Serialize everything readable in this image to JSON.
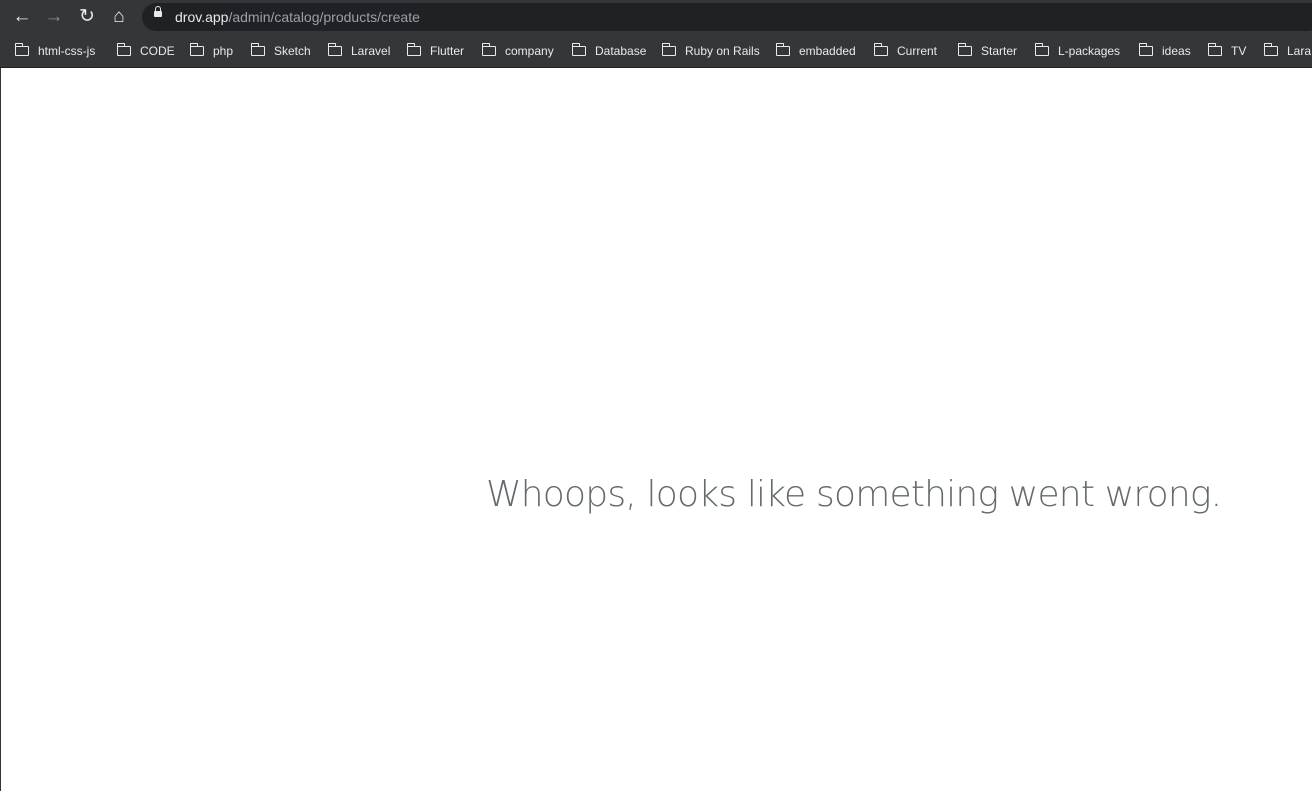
{
  "browser": {
    "url_host": "drov.app",
    "url_path": "/admin/catalog/products/create",
    "bookmarks": [
      "html-css-js",
      "CODE",
      "php",
      "Sketch",
      "Laravel",
      "Flutter",
      "company",
      "Database",
      "Ruby on Rails",
      "embadded",
      "Current",
      "Starter",
      "L-packages",
      "ideas",
      "TV",
      "Lara"
    ]
  },
  "page": {
    "message": "Whoops, looks like something went wrong.",
    "message_color": "#636b6f"
  }
}
